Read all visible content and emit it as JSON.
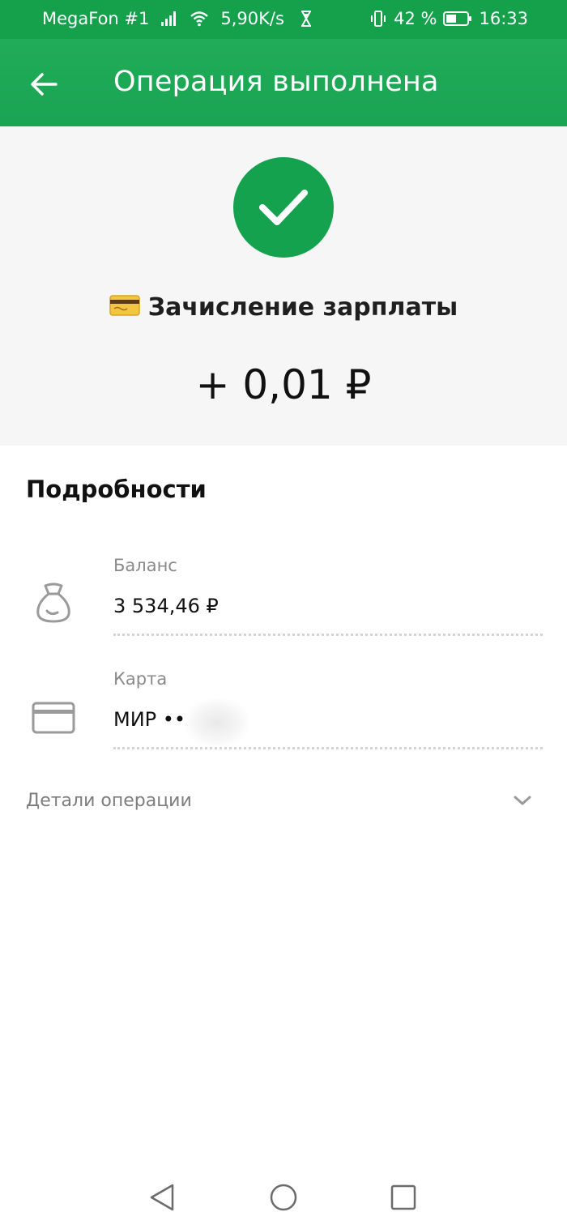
{
  "status_bar": {
    "carrier": "MegaFon #1",
    "speed": "5,90K/s",
    "battery": "42 %",
    "time": "16:33"
  },
  "app_bar": {
    "title": "Операция выполнена"
  },
  "operation": {
    "title": "Зачисление зарплаты",
    "amount": "+ 0,01 ₽"
  },
  "details": {
    "heading": "Подробности",
    "rows": [
      {
        "label": "Баланс",
        "value": "3 534,46 ₽",
        "icon": "money-bag-icon"
      },
      {
        "label": "Карта",
        "value": "МИР ••",
        "icon": "card-icon"
      }
    ],
    "operation_details_label": "Детали операции"
  },
  "colors": {
    "brand_green": "#21a84f",
    "success_green": "#14a24e",
    "hero_bg": "#f6f6f6",
    "label_gray": "#8a8a8a"
  }
}
